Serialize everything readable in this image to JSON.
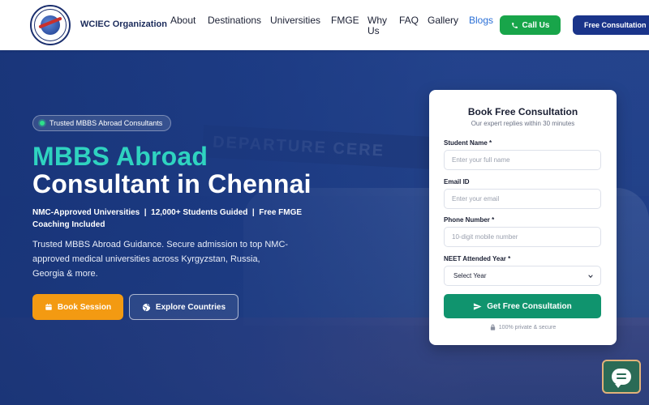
{
  "brand": {
    "name": "WCIEC Organization"
  },
  "nav": {
    "items": [
      {
        "label": "About",
        "active": false
      },
      {
        "label": "Destinations",
        "active": false
      },
      {
        "label": "Universities",
        "active": false
      },
      {
        "label": "FMGE",
        "active": false
      },
      {
        "label": "Why Us",
        "active": false
      },
      {
        "label": "FAQ",
        "active": false
      },
      {
        "label": "Gallery",
        "active": false
      },
      {
        "label": "Blogs",
        "active": true
      }
    ],
    "call_label": "Call Us",
    "free_label": "Free Consultation"
  },
  "hero": {
    "badge": "Trusted MBBS Abroad Consultants",
    "title_line1": "MBBS Abroad",
    "title_line2": "Consultant in Chennai",
    "stats": "NMC-Approved Universities  |  12,000+ Students Guided  |  Free FMGE Coaching Included",
    "description": "Trusted MBBS Abroad Guidance. Secure admission to top NMC-approved medical universities across Kyrgyzstan, Russia, Georgia & more.",
    "book_label": "Book Session",
    "explore_label": "Explore Countries"
  },
  "form": {
    "title": "Book Free Consultation",
    "subtitle": "Our expert replies within 30 minutes",
    "name_label": "Student Name *",
    "name_placeholder": "Enter your full name",
    "email_label": "Email ID",
    "email_placeholder": "Enter your email",
    "phone_label": "Phone Number *",
    "phone_placeholder": "10-digit mobile number",
    "neet_label": "NEET Attended Year *",
    "neet_value": "Select Year",
    "submit_label": "Get Free Consultation",
    "secure_note": "100% private & secure"
  },
  "colors": {
    "accent_teal": "#2fd3c0",
    "call_green": "#18a54a",
    "submit_green": "#10946e",
    "book_orange": "#f39a12",
    "navy": "#1a348a"
  },
  "icons": {
    "call": "phone-icon",
    "book": "calendar-icon",
    "explore": "globe-icon",
    "submit": "send-icon",
    "secure": "lock-icon",
    "chat": "chat-icon"
  }
}
